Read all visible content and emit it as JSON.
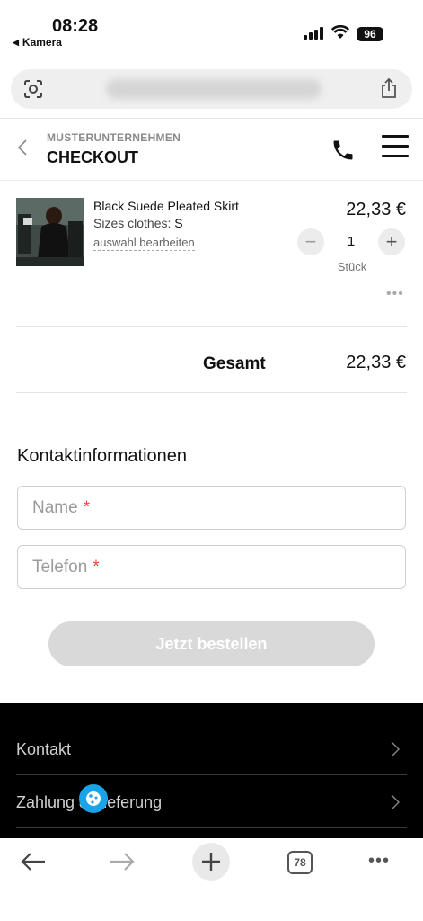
{
  "status_bar": {
    "time": "08:28",
    "back_app": "Kamera",
    "battery": "96"
  },
  "header": {
    "company": "MUSTERUNTERNEHMEN",
    "title": "CHECKOUT"
  },
  "cart": {
    "item": {
      "name": "Black Suede Pleated Skirt",
      "size_label": "Sizes clothes:",
      "size_value": "S",
      "edit_link": "auswahl bearbeiten",
      "price": "22,33 €",
      "quantity": "1",
      "unit": "Stück"
    },
    "total_label": "Gesamt",
    "total_price": "22,33 €"
  },
  "contact": {
    "title": "Kontaktinformationen",
    "name_placeholder": "Name",
    "phone_placeholder": "Telefon",
    "required_mark": "*",
    "order_button": "Jetzt bestellen"
  },
  "footer": {
    "items": [
      {
        "label": "Kontakt"
      },
      {
        "label": "Zahlung & Lieferung"
      }
    ]
  },
  "toolbar": {
    "tab_count": "78"
  },
  "icons": {
    "phone": "phone-icon",
    "menu": "hamburger-menu-icon",
    "cookie": "cookie-icon"
  }
}
